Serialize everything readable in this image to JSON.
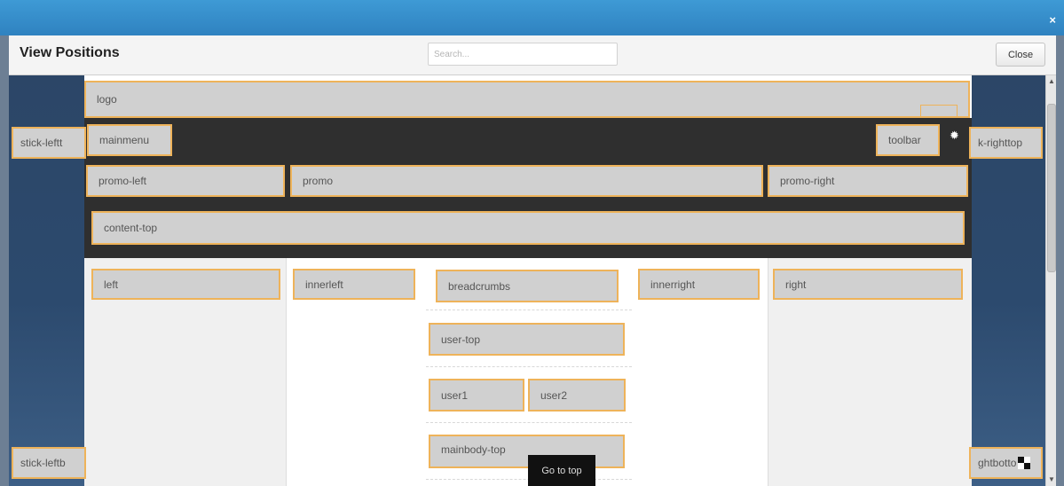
{
  "dialog": {
    "title": "View Positions",
    "close_x": "×",
    "search_placeholder": "Search...",
    "close_label": "Close"
  },
  "positions": {
    "logo": "logo",
    "mainmenu": "mainmenu",
    "toolbar": "toolbar",
    "promo_left": "promo-left",
    "promo": "promo",
    "promo_right": "promo-right",
    "content_top": "content-top",
    "left": "left",
    "innerleft": "innerleft",
    "breadcrumbs": "breadcrumbs",
    "innerright": "innerright",
    "right": "right",
    "user_top": "user-top",
    "user1": "user1",
    "user2": "user2",
    "mainbody_top": "mainbody-top",
    "stick_lefttop": "stick-leftt",
    "stick_righttop": "k-righttop",
    "stick_leftbottom": "stick-leftb",
    "stick_rightbottom": "ghtbotto"
  },
  "goto_top": "Go to top",
  "icons": {
    "settings": "gear-icon",
    "close": "close-icon"
  },
  "colors": {
    "titlebar": "#2f82c0",
    "position_border": "#eeb35a",
    "position_bg": "#d0d0d0"
  }
}
